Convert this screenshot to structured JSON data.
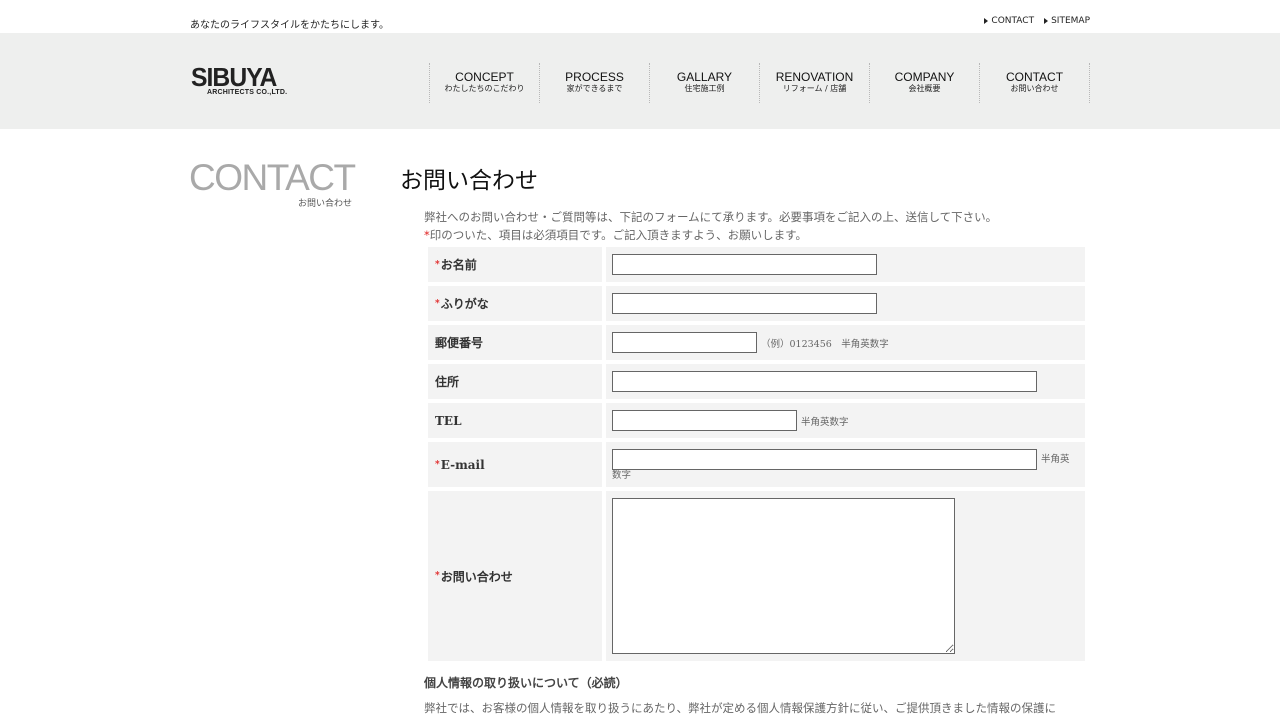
{
  "top": {
    "tagline": "あなたのライフスタイルをかたちにします。",
    "links": [
      {
        "label": "CONTACT"
      },
      {
        "label": "SITEMAP"
      }
    ]
  },
  "logo": {
    "main": "SIBUYA",
    "sub": "ARCHITECTS CO.,LTD."
  },
  "nav": [
    {
      "en": "CONCEPT",
      "jp": "わたしたちのこだわり"
    },
    {
      "en": "PROCESS",
      "jp": "家ができるまで"
    },
    {
      "en": "GALLARY",
      "jp": "住宅施工例"
    },
    {
      "en": "RENOVATION",
      "jp": "リフォーム / 店舗"
    },
    {
      "en": "COMPANY",
      "jp": "会社概要"
    },
    {
      "en": "CONTACT",
      "jp": "お問い合わせ"
    }
  ],
  "side": {
    "title": "CONTACT",
    "subtitle": "お問い合わせ"
  },
  "main": {
    "title": "お問い合わせ",
    "intro_line1": "弊社へのお問い合わせ・ご質問等は、下記のフォームにて承ります。必要事項をご記入の上、送信して下さい。",
    "intro_mark": "*",
    "intro_line2": "印のついた、項目は必須項目です。ご記入頂きますよう、お願いします。"
  },
  "form": {
    "required_mark": "*",
    "name_label": "お名前",
    "kana_label": "ふりがな",
    "zip_label": "郵便番号",
    "zip_hint": "（例）0123456　半角英数字",
    "address_label": "住所",
    "tel_label": "TEL",
    "tel_hint": "半角英数字",
    "email_label": "E-mail",
    "email_hint_1": "半角英",
    "email_hint_2": "数字",
    "message_label": "お問い合わせ"
  },
  "privacy": {
    "title": "個人情報の取り扱いについて（必読）",
    "text": "弊社では、お客様の個人情報を取り扱うにあたり、弊社が定める個人情報保護方針に従い、ご提供頂きました情報の保護に"
  }
}
